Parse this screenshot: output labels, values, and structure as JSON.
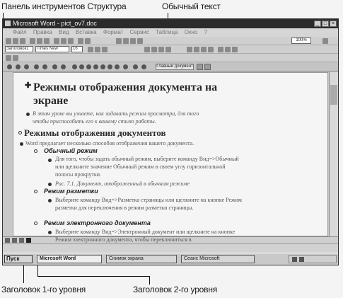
{
  "callouts": {
    "outline_toolbar": "Панель инструментов Структура",
    "normal_text": "Обычный текст",
    "heading1": "Заголовок 1-го уровня",
    "heading2": "Заголовок 2-го уровня"
  },
  "window": {
    "title": "Microsoft Word - pict_ov7.doc"
  },
  "formatting": {
    "style": "Заголовок1",
    "font": "Times New Roman",
    "size": "16",
    "zoom": "100%"
  },
  "outline_toolbar": {
    "master_document": "Главный документ"
  },
  "document": {
    "title": "Режимы отображения документа на экране",
    "intro": "В этом уроке вы узнаете, как задавать режим просмотра, для того чтобы приспособить его к вашему стилю работы.",
    "section_heading": "Режимы отображения документов",
    "section_intro": "Word предлагает несколько способов отображения вашего документа.",
    "items": [
      {
        "heading": "Обычный режим",
        "paragraphs": [
          "Для того, чтобы задать обычный режим, выберите команду Вид=>Обычный или щелкните значение Обычный режим в своем углу горизонтальной полосы прокрутки.",
          "Рис. 7.1. Документ, отображенный в обычном режиме"
        ]
      },
      {
        "heading": "Режим разметки",
        "paragraphs": [
          "Выберите команду Вид=>Разметка страницы или щелкните на кнопке Режим разметки для переключения в режим разметки страницы."
        ]
      },
      {
        "heading": "Режим электронного документа",
        "paragraphs": [
          "Выберите команду Вид=>Электронный документ или щелкните на кнопке Режим электронного документа, чтобы переключиться в"
        ]
      }
    ]
  },
  "taskbar": {
    "start": "Пуск",
    "tasks": [
      "Microsoft Word",
      "Снимок экрана",
      "Сеанс Microsoft"
    ]
  }
}
